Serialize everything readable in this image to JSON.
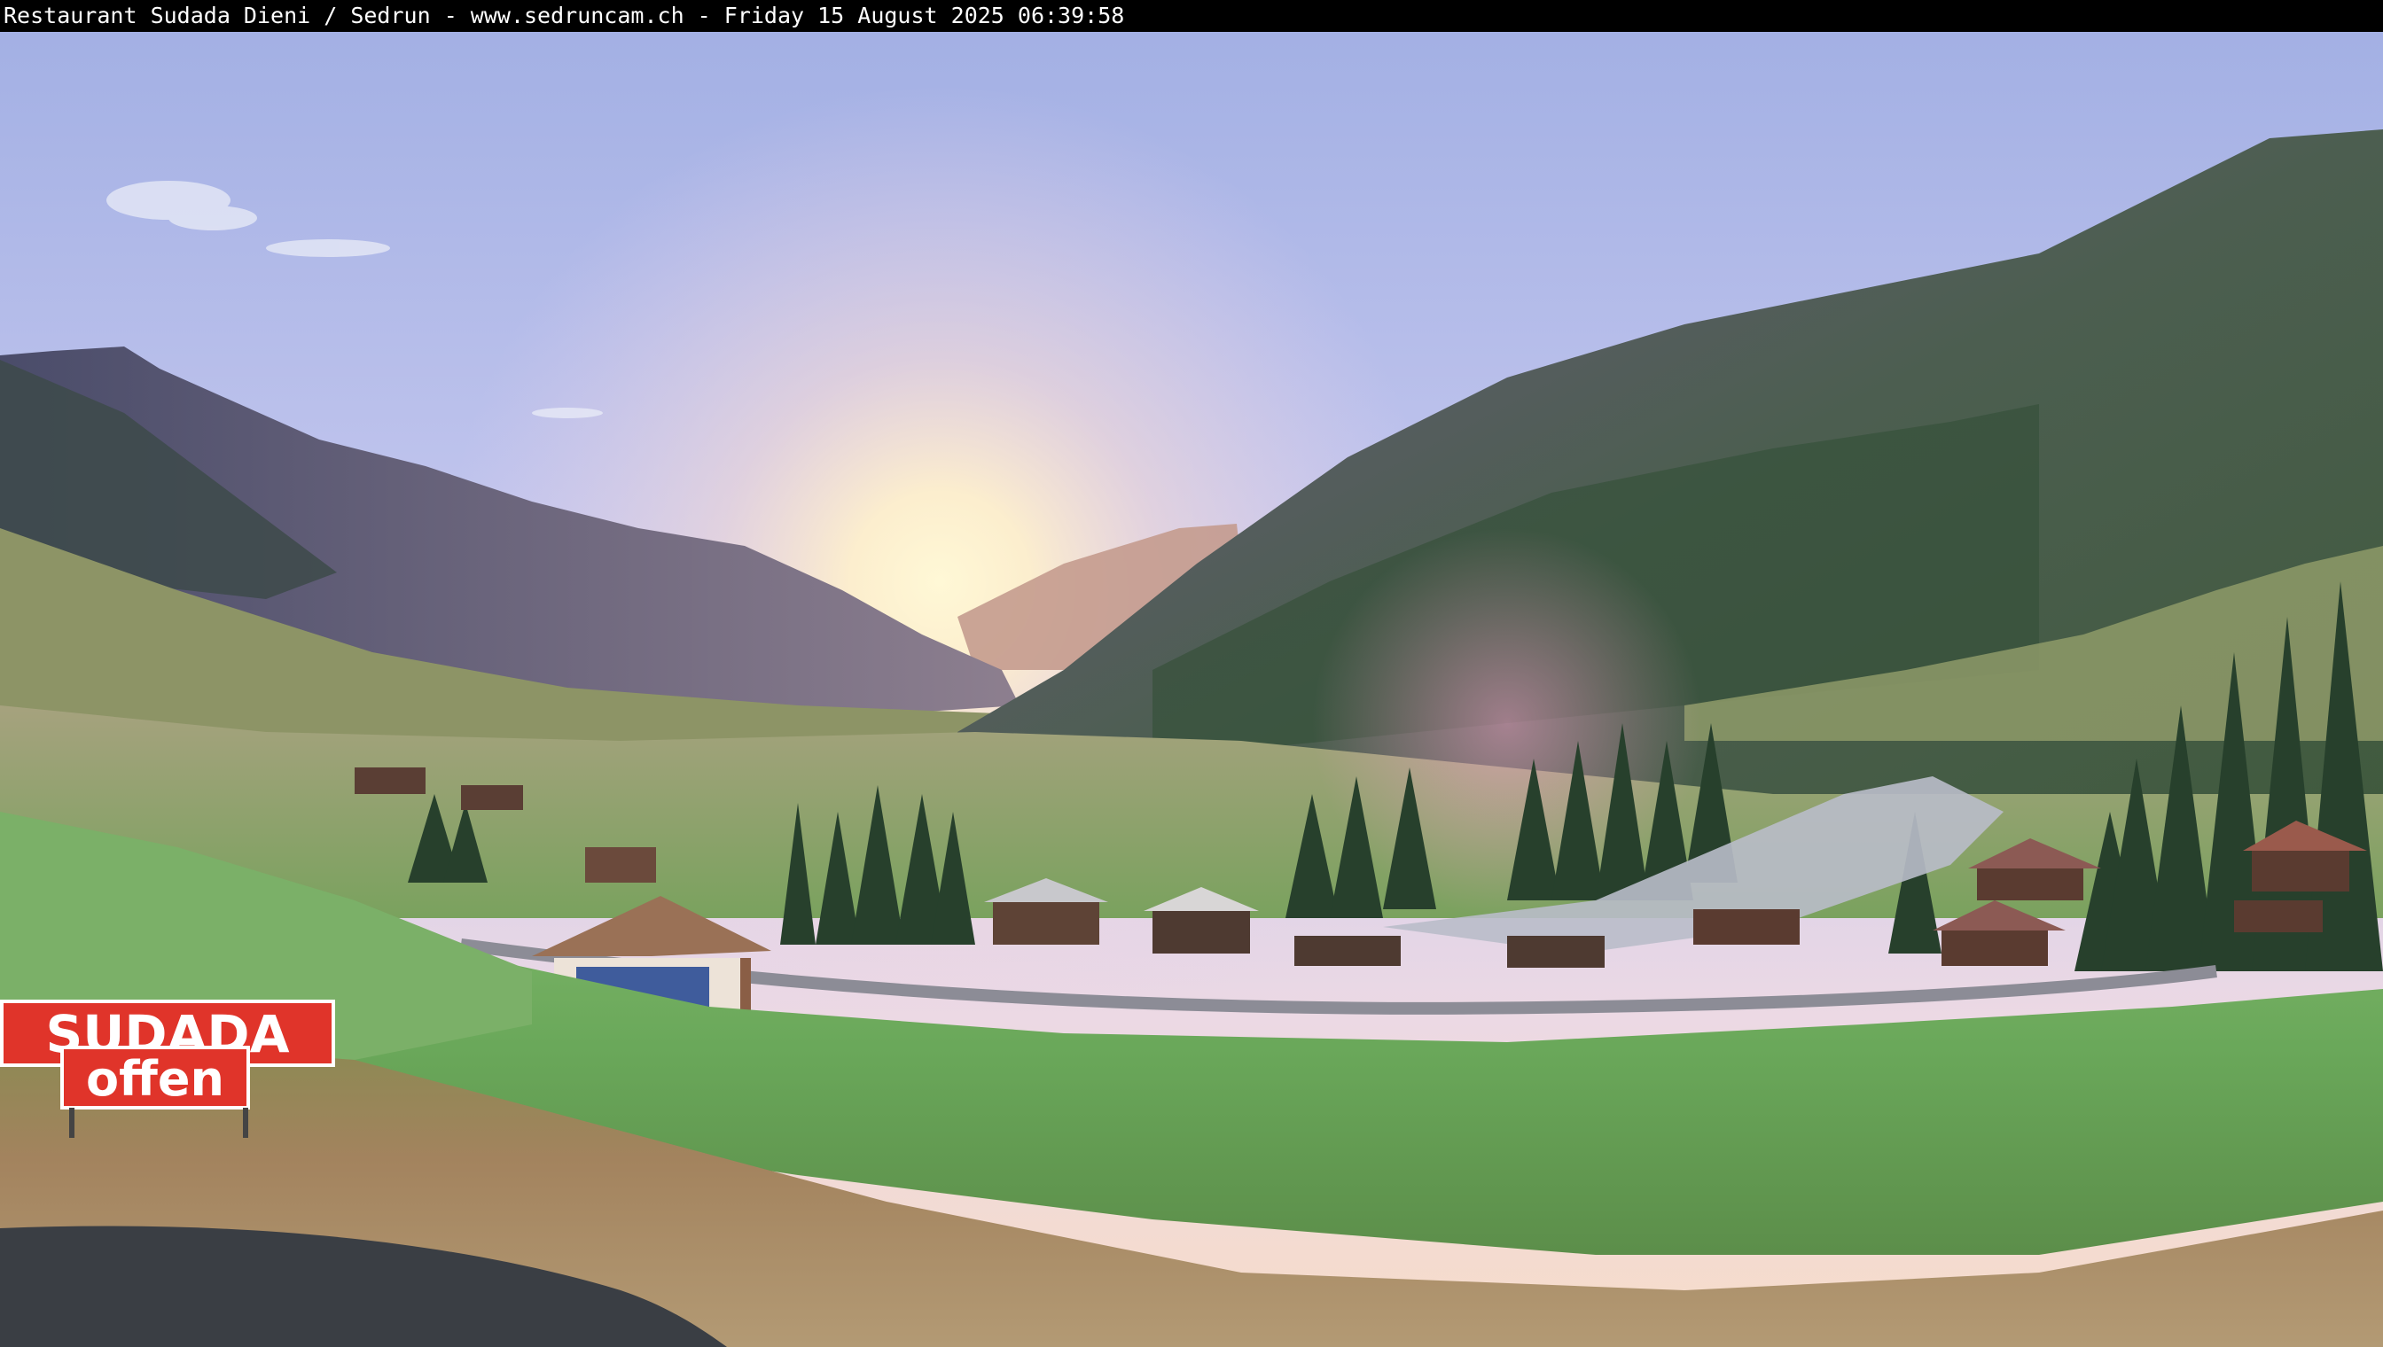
{
  "caption": {
    "text": "Restaurant Sudada Dieni / Sedrun - www.sedruncam.ch - Friday 15 August 2025 06:39:58"
  },
  "signs": {
    "restaurant_name": "SUDADA",
    "status": "offen"
  },
  "colors": {
    "sign_red": "#e0342a",
    "sign_border": "#ffffff",
    "caption_background": "#000000",
    "caption_text": "#ffffff",
    "sky_top": "#a9b6e6",
    "sun_glow": "#fff3cf",
    "meadow_green": "#6aa85a"
  }
}
